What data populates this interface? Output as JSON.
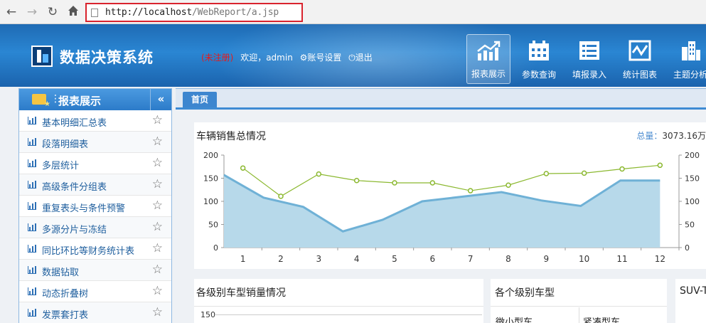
{
  "browser": {
    "url_host": "http://localhost",
    "url_path": "/WebReport/a.jsp",
    "back_icon": "arrow-left-icon",
    "forward_icon": "arrow-right-icon",
    "reload_icon": "reload-icon",
    "home_icon": "home-icon"
  },
  "header": {
    "title": "数据决策系统",
    "unregistered": "(未注册)",
    "welcome": "欢迎，admin",
    "account_settings": "账号设置",
    "logout": "退出",
    "tools": [
      {
        "label": "报表展示",
        "icon": "chart-up-icon",
        "active": true
      },
      {
        "label": "参数查询",
        "icon": "calendar-icon",
        "active": false
      },
      {
        "label": "填报录入",
        "icon": "list-icon",
        "active": false
      },
      {
        "label": "统计图表",
        "icon": "line-chart-icon",
        "active": false
      },
      {
        "label": "主题分析",
        "icon": "buildings-icon",
        "active": false
      }
    ]
  },
  "sidebar": {
    "title": "报表展示",
    "collapse": "«",
    "items": [
      {
        "label": "基本明细汇总表"
      },
      {
        "label": "段落明细表"
      },
      {
        "label": "多层统计"
      },
      {
        "label": "高级条件分组表"
      },
      {
        "label": "重复表头与条件预警"
      },
      {
        "label": "多源分片与冻结"
      },
      {
        "label": "同比环比等财务统计表"
      },
      {
        "label": "数据钻取"
      },
      {
        "label": "动态折叠树"
      },
      {
        "label": "发票套打表"
      }
    ]
  },
  "tabs": {
    "home": "首页"
  },
  "sales_card": {
    "title": "车辆销售总情况",
    "total_label": "总量：",
    "total_value": "3073.16万"
  },
  "lower": {
    "level_sales_title": "各级别车型销量情况",
    "level_sales_y_top": "150",
    "car_level_title": "各个级别车型",
    "car_level_col1": "微小型车",
    "car_level_col2": "紧凑型车",
    "suv_title": "SUV-T"
  },
  "chart_data": {
    "type": "area",
    "title": "车辆销售总情况",
    "categories": [
      "1",
      "2",
      "3",
      "4",
      "5",
      "6",
      "7",
      "8",
      "9",
      "10",
      "11",
      "12"
    ],
    "series": [
      {
        "type": "area",
        "color": "#6fb1d6",
        "fill": "#b7d9ea",
        "values": [
          157,
          108,
          88,
          35,
          60,
          100,
          110,
          120,
          102,
          90,
          145,
          145
        ]
      },
      {
        "type": "line",
        "color": "#8bb82f",
        "values": [
          172,
          111,
          159,
          145,
          140,
          140,
          123,
          135,
          160,
          161,
          170,
          178
        ]
      }
    ],
    "y_ticks": [
      0,
      50,
      100,
      150,
      200
    ],
    "ylim": [
      0,
      200
    ],
    "xlabel": "",
    "ylabel": "",
    "grid": false
  }
}
